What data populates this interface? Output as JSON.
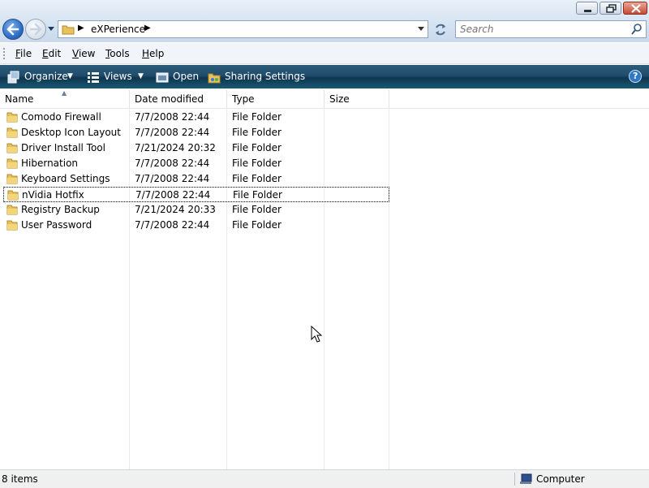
{
  "window": {
    "controls": {
      "minimize": "minimize",
      "maximize": "maximize",
      "close": "close"
    }
  },
  "address": {
    "path": "eXPerience",
    "search_placeholder": "Search"
  },
  "menu": [
    "File",
    "Edit",
    "View",
    "Tools",
    "Help"
  ],
  "commands": {
    "organize": "Organize",
    "views": "Views",
    "open": "Open",
    "sharing": "Sharing Settings"
  },
  "columns": [
    "Name",
    "Date modified",
    "Type",
    "Size"
  ],
  "files": [
    {
      "name": "Comodo Firewall",
      "date": "7/7/2008 22:44",
      "type": "File Folder",
      "size": ""
    },
    {
      "name": "Desktop Icon Layout",
      "date": "7/7/2008 22:44",
      "type": "File Folder",
      "size": ""
    },
    {
      "name": "Driver Install Tool",
      "date": "7/21/2024 20:32",
      "type": "File Folder",
      "size": ""
    },
    {
      "name": "Hibernation",
      "date": "7/7/2008 22:44",
      "type": "File Folder",
      "size": ""
    },
    {
      "name": "Keyboard Settings",
      "date": "7/7/2008 22:44",
      "type": "File Folder",
      "size": ""
    },
    {
      "name": "nVidia Hotfix",
      "date": "7/7/2008 22:44",
      "type": "File Folder",
      "size": ""
    },
    {
      "name": "Registry Backup",
      "date": "7/21/2024 20:33",
      "type": "File Folder",
      "size": ""
    },
    {
      "name": "User Password",
      "date": "7/7/2008 22:44",
      "type": "File Folder",
      "size": ""
    }
  ],
  "selected_index": 5,
  "status": {
    "count": "8 items",
    "zone": "Computer"
  },
  "colors": {
    "command_bar": "#1f4d6b",
    "folder": "#e8c25a",
    "close_button": "#c64a32"
  }
}
